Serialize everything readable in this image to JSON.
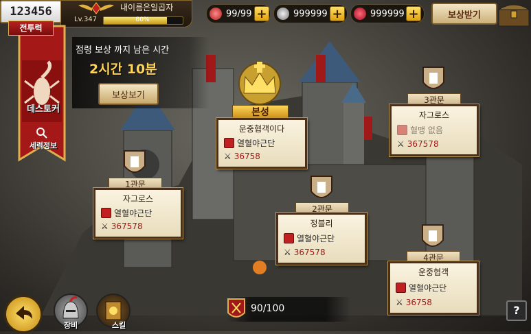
{
  "colors": {
    "accent_gold": "#ffd45a",
    "score_red": "#a01818",
    "banner_red": "#b82020",
    "card_bg": "#faf3e0"
  },
  "top_bar": {
    "power": "123456",
    "player_name": "내이름은일곱자",
    "level": "Lv.347",
    "exp_percent": 80,
    "exp_text": "80%",
    "resources": [
      {
        "icon": "meat-icon",
        "value": "99/99"
      },
      {
        "icon": "silver-coin-icon",
        "value": "999999"
      },
      {
        "icon": "ruby-icon",
        "value": "999999"
      }
    ],
    "reward_button": "보상받기"
  },
  "banner": {
    "tag": "전투력",
    "name": "데스토커",
    "info": "세력정보",
    "emblem_icon": "scorpion-icon"
  },
  "occupation": {
    "label": "점령 보상 까지 남은 시간",
    "time": "2시간 10분",
    "button": "보상보기"
  },
  "main_castle": {
    "ribbon": "본성",
    "name": "운중협객이다",
    "guild": "열혈야근단",
    "score": "36758"
  },
  "gates": [
    {
      "ribbon": "1관문",
      "name": "자그로스",
      "guild": "열혈야근단",
      "score": "367578",
      "guild_muted": false
    },
    {
      "ribbon": "2관문",
      "name": "정블리",
      "guild": "열혈야근단",
      "score": "367578",
      "guild_muted": false
    },
    {
      "ribbon": "3관문",
      "name": "자그로스",
      "guild": "혈맹 없음",
      "score": "367578",
      "guild_muted": true
    },
    {
      "ribbon": "4관문",
      "name": "운중협객",
      "guild": "열혈야근단",
      "score": "36758",
      "guild_muted": false
    }
  ],
  "bottom": {
    "equip_label": "장비",
    "skill_label": "스킬",
    "stamina": "90/100",
    "help": "?"
  }
}
